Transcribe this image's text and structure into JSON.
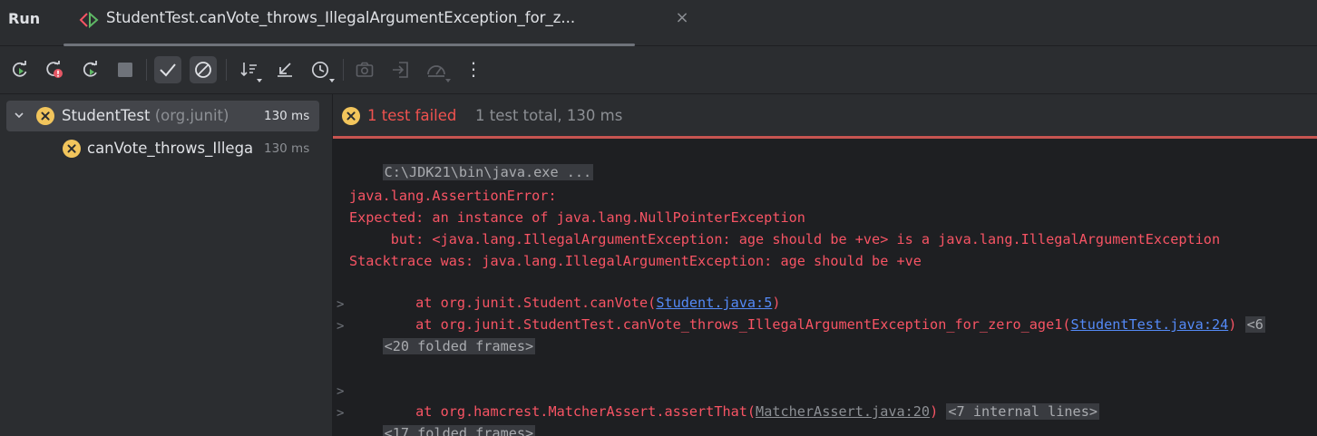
{
  "header": {
    "run_title": "Run",
    "tab_label": "StudentTest.canVote_throws_IllegalArgumentException_for_z...",
    "tab_close": "×"
  },
  "toolbar": {
    "buttons": [
      "rerun-icon",
      "rerun-failed-icon",
      "toggle-auto-test-icon",
      "stop-icon",
      "show-passed-icon",
      "show-ignored-icon",
      "sort-icon",
      "collapse-icon",
      "history-icon",
      "screenshot-icon",
      "import-icon",
      "coverage-icon",
      "more-icon"
    ],
    "more_label": "⋮"
  },
  "tree": {
    "root": {
      "name": "StudentTest",
      "package": "(org.junit)",
      "time": "130 ms"
    },
    "child": {
      "name": "canVote_throws_Illega",
      "time": "130 ms"
    }
  },
  "status": {
    "failed": "1 test failed",
    "total": "1 test total, 130 ms"
  },
  "console": {
    "cmd": "C:\\JDK21\\bin\\java.exe ...",
    "l1": "java.lang.AssertionError:",
    "l2": "Expected: an instance of java.lang.NullPointerException",
    "l3": "     but: <java.lang.IllegalArgumentException: age should be +ve> is a java.lang.IllegalArgumentException",
    "l4": "Stacktrace was: java.lang.IllegalArgumentException: age should be +ve",
    "l5_pre": "    at org.junit.Student.canVote(",
    "l5_link": "Student.java:5",
    "l5_post": ")",
    "l6_pre": "    at org.junit.StudentTest.canVote_throws_IllegalArgumentException_for_zero_age1(",
    "l6_link": "StudentTest.java:24",
    "l6_post": ")",
    "l6_chip": "<6",
    "fold1": "<20 folded frames>",
    "l7_pre": "    at org.hamcrest.MatcherAssert.assertThat(",
    "l7_link": "MatcherAssert.java:20",
    "l7_post": ")",
    "l7_chip": "<7 internal lines>",
    "fold2": "<17 folded frames>",
    "gutter_arrow": ">"
  },
  "colors": {
    "error_text": "#f75464",
    "fail_icon": "#f2c55c",
    "status_line": "#c75450",
    "link": "#548af7"
  }
}
